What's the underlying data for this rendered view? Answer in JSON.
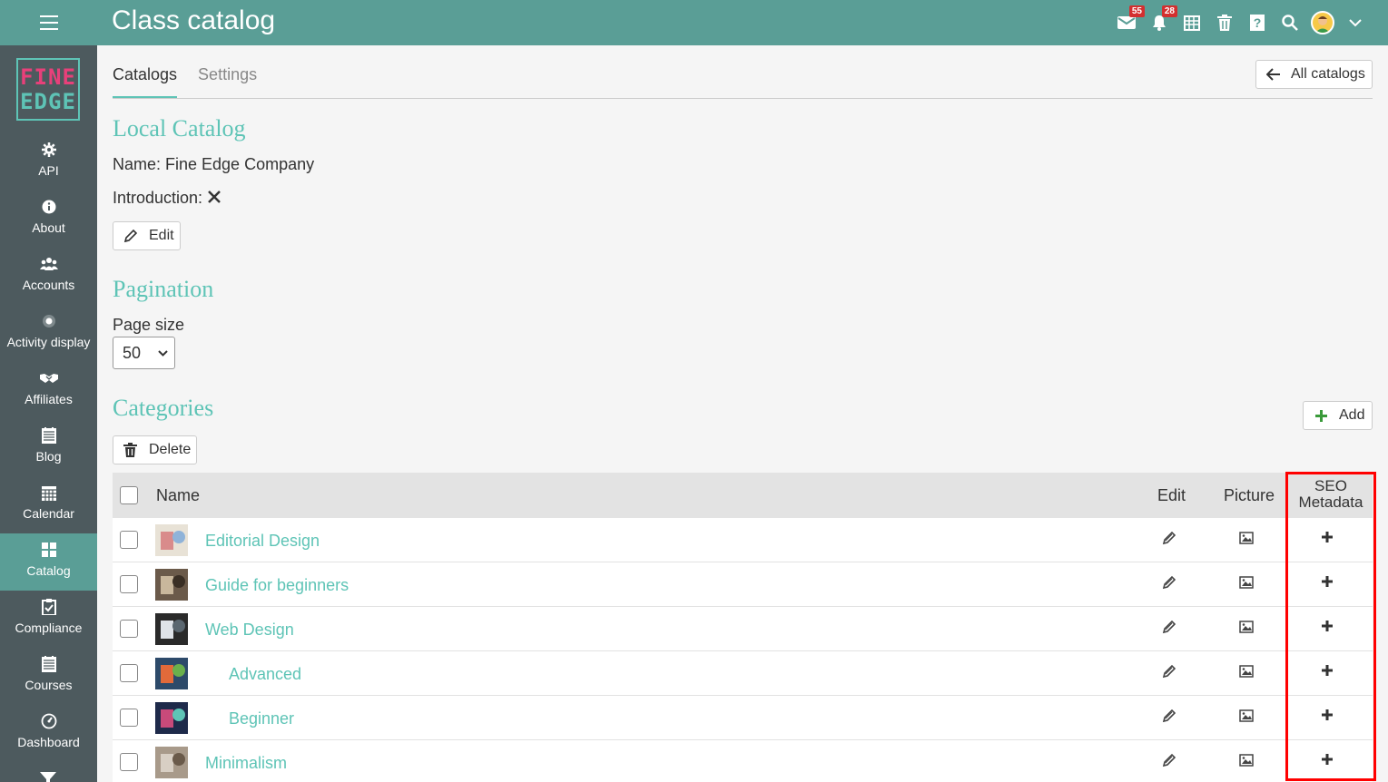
{
  "header": {
    "title": "Class catalog",
    "mail_badge": "55",
    "notif_badge": "28"
  },
  "sidebar": {
    "logo_line1": "FINE",
    "logo_line2": "EDGE",
    "items": [
      {
        "label": "API",
        "icon": "gear-icon"
      },
      {
        "label": "About",
        "icon": "info-icon"
      },
      {
        "label": "Accounts",
        "icon": "users-icon"
      },
      {
        "label": "Activity display",
        "icon": "radio-icon"
      },
      {
        "label": "Affiliates",
        "icon": "handshake-icon"
      },
      {
        "label": "Blog",
        "icon": "blog-icon"
      },
      {
        "label": "Calendar",
        "icon": "calendar-icon"
      },
      {
        "label": "Catalog",
        "icon": "grid-icon",
        "active": true
      },
      {
        "label": "Compliance",
        "icon": "clipboard-check-icon"
      },
      {
        "label": "Courses",
        "icon": "courses-icon"
      },
      {
        "label": "Dashboard",
        "icon": "dashboard-icon"
      }
    ]
  },
  "tabs": [
    {
      "label": "Catalogs"
    },
    {
      "label": "Settings"
    }
  ],
  "all_catalogs_label": "All catalogs",
  "local_catalog": {
    "title": "Local Catalog",
    "name_text": "Name: Fine Edge Company",
    "intro_label": "Introduction:",
    "edit_label": "Edit"
  },
  "pagination": {
    "title": "Pagination",
    "page_size_label": "Page size",
    "page_size_value": "50"
  },
  "categories": {
    "title": "Categories",
    "add_label": "Add",
    "delete_label": "Delete",
    "columns": {
      "name": "Name",
      "edit": "Edit",
      "picture": "Picture",
      "seo_line1": "SEO",
      "seo_line2": "Metadata"
    },
    "rows": [
      {
        "name": "Editorial Design",
        "indent": false
      },
      {
        "name": "Guide for beginners",
        "indent": false
      },
      {
        "name": "Web Design",
        "indent": false
      },
      {
        "name": "Advanced",
        "indent": true
      },
      {
        "name": "Beginner",
        "indent": true
      },
      {
        "name": "Minimalism",
        "indent": false
      }
    ]
  },
  "colors": {
    "accent": "#5ec4b6",
    "topbar": "#5a9e96",
    "sidebar": "#4d5a5e",
    "highlight": "#ff0000"
  }
}
